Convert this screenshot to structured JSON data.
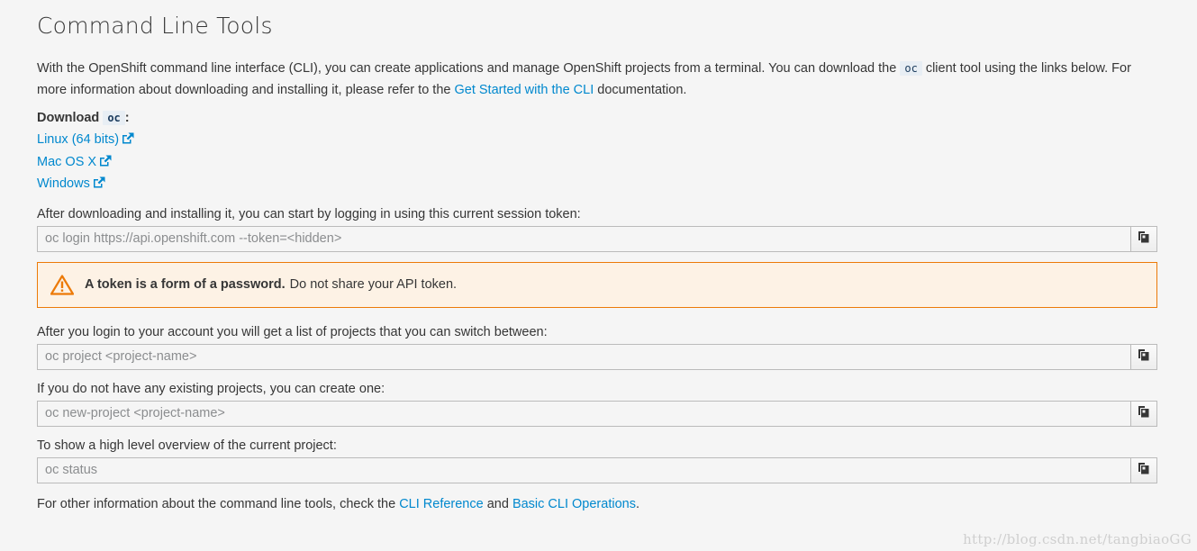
{
  "page": {
    "title": "Command Line Tools"
  },
  "intro": {
    "text_before_code": "With the OpenShift command line interface (CLI), you can create applications and manage OpenShift projects from a terminal. You can download the ",
    "code": "oc",
    "text_after_code": " client tool using the links below. For more information about downloading and installing it, please refer to the ",
    "link_label": "Get Started with the CLI",
    "text_end": " documentation."
  },
  "download": {
    "heading_prefix": "Download",
    "heading_code": "oc",
    "heading_suffix": ":",
    "links": [
      {
        "label": "Linux (64 bits)",
        "icon": "external-link-icon"
      },
      {
        "label": "Mac OS X",
        "icon": "external-link-icon"
      },
      {
        "label": "Windows",
        "icon": "external-link-icon"
      }
    ]
  },
  "login": {
    "label": "After downloading and installing it, you can start by logging in using this current session token:",
    "command": "oc login https://api.openshift.com --token=<hidden>"
  },
  "alert": {
    "icon": "warning-triangle-icon",
    "strong": "A token is a form of a password.",
    "text": "Do not share your API token."
  },
  "project_switch": {
    "label": "After you login to your account you will get a list of projects that you can switch between:",
    "command": "oc project <project-name>"
  },
  "new_project": {
    "label": "If you do not have any existing projects, you can create one:",
    "command": "oc new-project <project-name>"
  },
  "status": {
    "label": "To show a high level overview of the current project:",
    "command": "oc status"
  },
  "footer": {
    "text_before": "For other information about the command line tools, check the ",
    "link1": "CLI Reference",
    "text_mid": " and ",
    "link2": "Basic CLI Operations",
    "text_end": "."
  },
  "watermark": "http://blog.csdn.net/tangbiaoGG",
  "colors": {
    "link": "#0088ce",
    "alert_border": "#ec7a08",
    "alert_bg": "#fdf2e5",
    "background": "#f5f5f5"
  }
}
